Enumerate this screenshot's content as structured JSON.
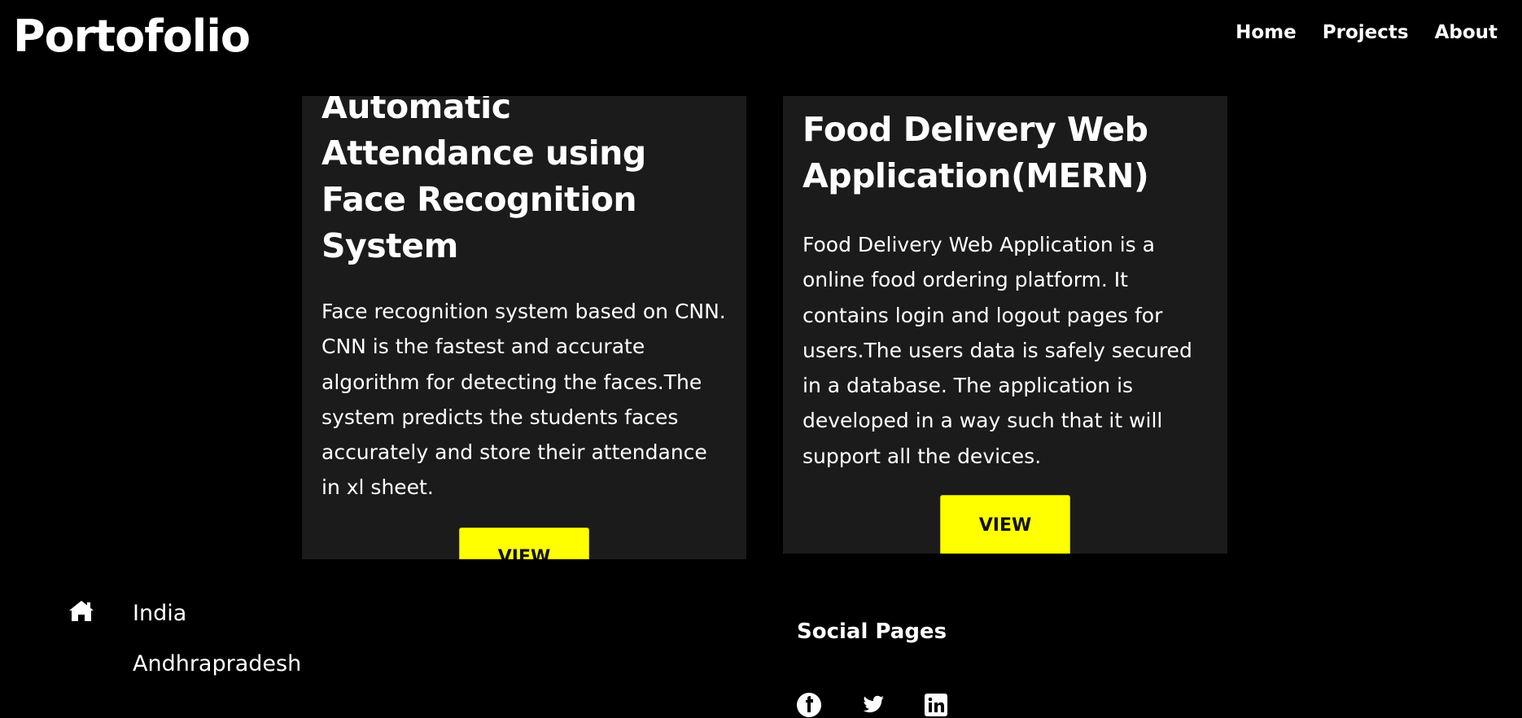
{
  "header": {
    "brand": "Portofolio",
    "nav": [
      "Home",
      "Projects",
      "About"
    ]
  },
  "projects": [
    {
      "title": "Automatic Attendance using Face Recognition System",
      "description": "Face recognition system based on CNN. CNN is the fastest and accurate algorithm for detecting the faces.The system predicts the students faces accurately and store their attendance in xl sheet.",
      "button": "VIEW"
    },
    {
      "title": "Food Delivery Web Application(MERN)",
      "description": "Food Delivery Web Application is a online food ordering platform. It contains login and logout pages for users.The users data is safely secured in a database. The application is developed in a way such that it will support all the devices.",
      "button": "VIEW"
    }
  ],
  "footer": {
    "location_icon": "home-icon",
    "location_line1": "India",
    "location_line2": "Andhrapradesh",
    "social_title": "Social Pages",
    "social_icons": [
      "facebook-icon",
      "twitter-icon",
      "linkedin-icon"
    ]
  },
  "colors": {
    "background": "#000000",
    "card": "#1b1b1b",
    "accent": "#ffff00"
  }
}
